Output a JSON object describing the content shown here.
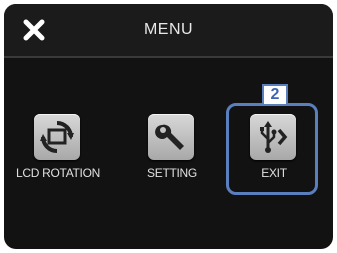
{
  "header": {
    "title": "MENU",
    "close_icon": "close-x-icon"
  },
  "menu_items": [
    {
      "label": "LCD ROTATION",
      "icon": "lcd-rotation-icon"
    },
    {
      "label": "SETTING",
      "icon": "wrench-icon"
    },
    {
      "label": "EXIT",
      "icon": "usb-exit-icon"
    }
  ],
  "annotation": {
    "step_number": "2",
    "highlight_item": "EXIT"
  },
  "colors": {
    "screen_bg": "#121212",
    "topbar_bg": "#1b1b1b",
    "text": "#e8e8e8",
    "highlight": "#5a7fbf",
    "badge_text": "#3f65b0"
  }
}
